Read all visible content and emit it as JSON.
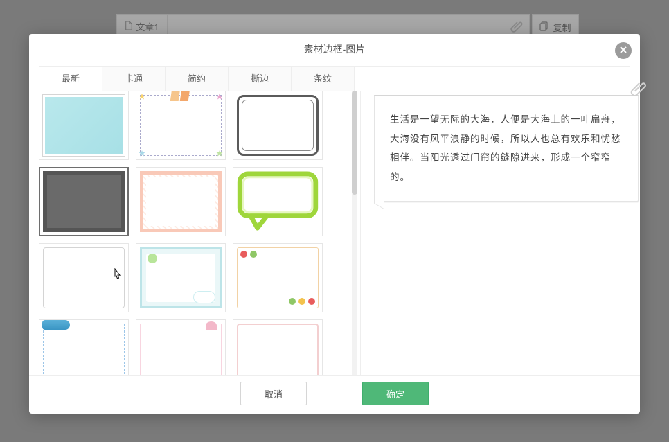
{
  "background": {
    "doc_tab_label": "文章1",
    "copy_button_label": "复制"
  },
  "modal": {
    "title": "素材边框-图片",
    "tabs": [
      "最新",
      "卡通",
      "简约",
      "撕边",
      "条纹"
    ],
    "active_tab_index": 0,
    "selected_thumb_index": 3,
    "sample_text": "生活是一望无际的大海，人便是大海上的一叶扁舟，大海没有风平浪静的时候，所以人也总有欢乐和忧愁相伴。当阳光透过门帘的缝隙进来，形成一个窄窄的。",
    "buttons": {
      "cancel": "取消",
      "ok": "确定"
    }
  }
}
